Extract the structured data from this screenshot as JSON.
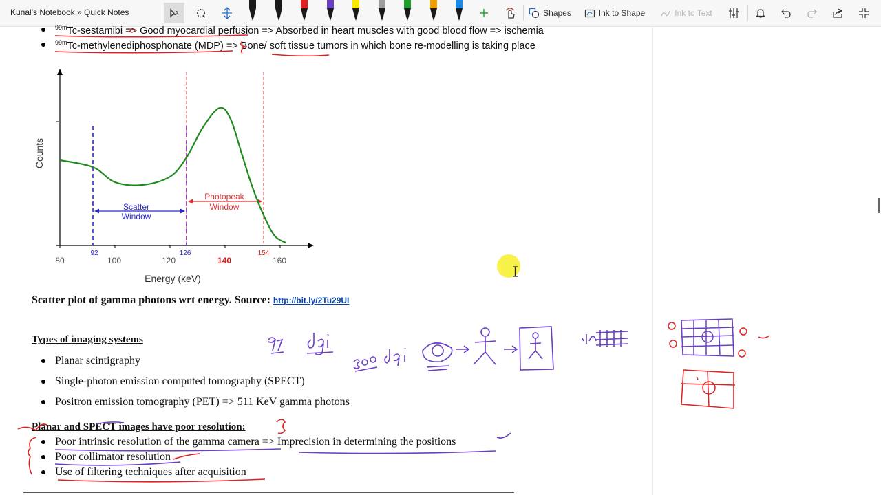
{
  "toolbar": {
    "breadcrumb": "Kunal's Notebook » Quick Notes",
    "shapes_label": "Shapes",
    "ink_to_shape_label": "Ink to Shape",
    "ink_to_text_label": "Ink to Text",
    "pens": [
      {
        "name": "black-marker",
        "color": "#1a1a1a"
      },
      {
        "name": "black-pen",
        "color": "#1a1a1a"
      },
      {
        "name": "red-pen",
        "color": "#e02020"
      },
      {
        "name": "purple-pen",
        "color": "#6a3fc4"
      },
      {
        "name": "yellow-highlighter",
        "color": "#f7e800"
      },
      {
        "name": "gray-pen",
        "color": "#9e9e9e"
      },
      {
        "name": "green-pen",
        "color": "#1f9e2e"
      },
      {
        "name": "orange-pen",
        "color": "#f0a000"
      },
      {
        "name": "blue-pen",
        "color": "#1e88e5"
      }
    ]
  },
  "notes": {
    "line1_sup": "99m",
    "line1_text": "Tc-sestamibi => Good myocardial perfusion => Absorbed in heart muscles with good blood flow => ischemia",
    "line2_sup": "99m",
    "line2_text": "Tc-methylenediphosphonate (MDP) => Bone/ soft tissue tumors in which bone re-modelling is taking place",
    "caption_text": "Scatter plot of gamma photons wrt energy. Source:",
    "caption_link": "http://bit.ly/2Tu29UI",
    "types_heading": "Types of imaging systems",
    "types_items": [
      "Planar scintigraphy",
      "Single-photon emission computed tomography (SPECT)",
      "Positron emission tomography (PET) => 511 KeV gamma photons"
    ],
    "resolution_heading": "Planar and SPECT images have poor resolution:",
    "resolution_items": [
      "Poor intrinsic resolution of the gamma camera => Imprecision in determining the positions",
      "Poor collimator resolution",
      "Use of filtering techniques after acquisition"
    ]
  },
  "chart": {
    "ylabel": "Counts",
    "xlabel": "Energy (keV)",
    "x_ticks": [
      "80",
      "100",
      "120",
      "140",
      "160"
    ],
    "window_ticks": [
      "92",
      "126",
      "154"
    ],
    "scatter_label_1": "Scatter",
    "scatter_label_2": "Window",
    "photopeak_label_1": "Photopeak",
    "photopeak_label_2": "Window"
  },
  "chart_data": {
    "type": "line",
    "xlabel": "Energy (keV)",
    "ylabel": "Counts",
    "x_ticks": [
      80,
      100,
      120,
      140,
      160
    ],
    "windows": [
      {
        "name": "Scatter Window",
        "from": 92,
        "to": 126,
        "color": "#2a2ad0"
      },
      {
        "name": "Photopeak Window",
        "from": 126,
        "to": 154,
        "color": "#e03030"
      }
    ],
    "series": [
      {
        "color": "#1f8a1f",
        "x": [
          80,
          92,
          100,
          110,
          120,
          126,
          132,
          138,
          142,
          146,
          150,
          154,
          158,
          162
        ],
        "y": [
          0.6,
          0.55,
          0.44,
          0.42,
          0.48,
          0.62,
          0.84,
          0.98,
          0.9,
          0.65,
          0.4,
          0.2,
          0.05,
          0.0
        ]
      }
    ]
  },
  "handwriting": {
    "dpi_note_1": "97 dpi",
    "dpi_note_2": "300 dpi"
  }
}
